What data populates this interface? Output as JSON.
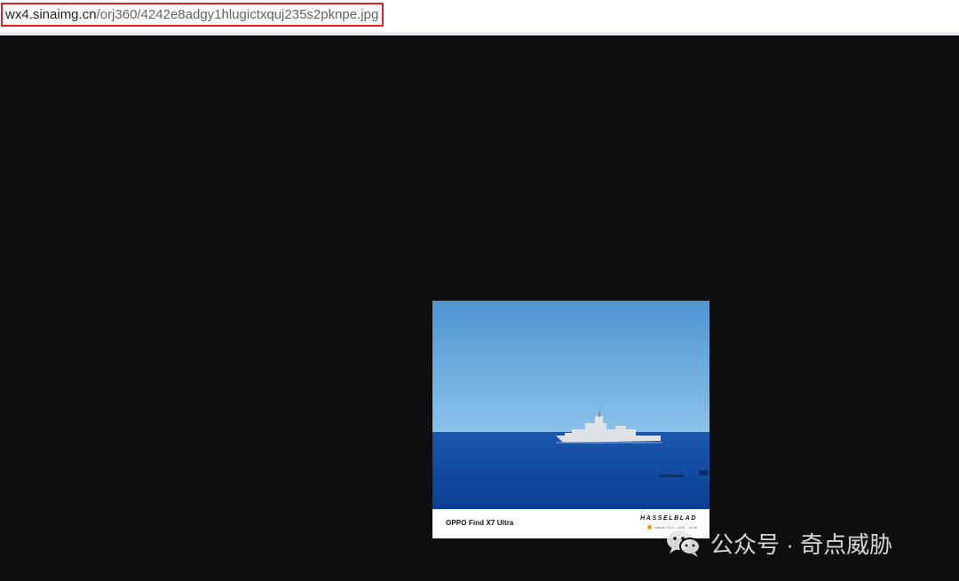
{
  "address_bar": {
    "url_host": "wx4.sinaimg.cn",
    "url_path": "/orj360/4242e8adgy1hlugictxquj235s2pknpe.jpg"
  },
  "photo": {
    "caption_model": "OPPO Find X7 Ultra",
    "caption_brand": "HASSELBLAD",
    "caption_meta": "Adhan, DLS · 2024 · 10:00"
  },
  "watermark": {
    "text": "公众号 · 奇点威胁"
  },
  "colors": {
    "background": "#0e0e0e",
    "url_highlight_border": "#e0202a",
    "sky": "#5a9fd6",
    "sea": "#0f4fa8",
    "accent_dot": "#f39a1f"
  }
}
